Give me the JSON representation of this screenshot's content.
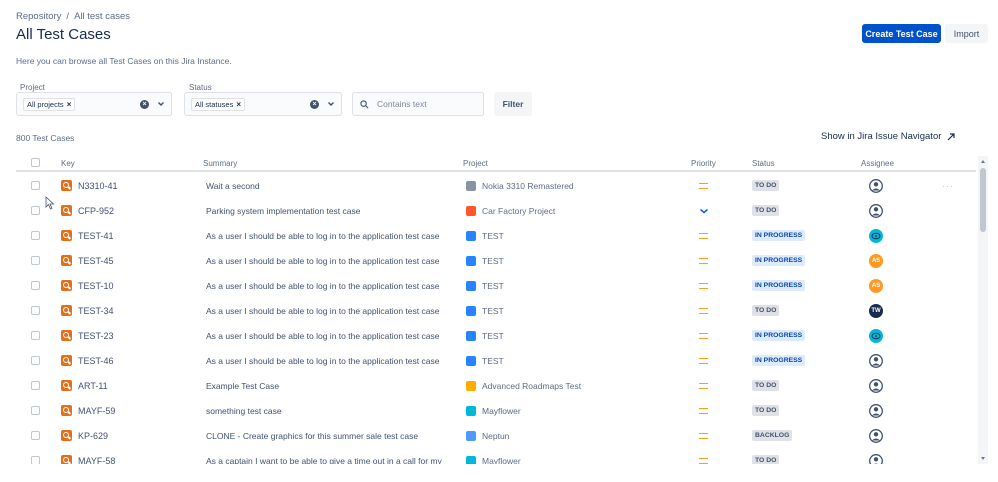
{
  "breadcrumb": {
    "items": [
      "Repository",
      "All test cases"
    ],
    "separator": "/"
  },
  "page": {
    "title": "All Test Cases",
    "description": "Here you can browse all Test Cases on this Jira Instance."
  },
  "actions": {
    "create_label": "Create Test Case",
    "import_label": "Import"
  },
  "filters": {
    "project_label": "Project",
    "project_chip": "All projects",
    "status_label": "Status",
    "status_chip": "All statuses",
    "search_placeholder": "Contains text",
    "filter_button": "Filter"
  },
  "summary": {
    "count_text": "800 Test Cases",
    "navigator_link": "Show in Jira Issue Navigator"
  },
  "table": {
    "columns": [
      "Key",
      "Summary",
      "Project",
      "Priority",
      "Status",
      "Assignee"
    ],
    "rows": [
      {
        "key": "N3310-41",
        "summary": "Wait a second",
        "project": "Nokia 3310 Remastered",
        "project_icon_color": "#8993a4",
        "priority": "medium",
        "status": "TO DO",
        "status_type": "todo",
        "assignee": ""
      },
      {
        "key": "CFP-952",
        "summary": "Parking system implementation test case",
        "project": "Car Factory Project",
        "project_icon_color": "#ff5630",
        "priority": "low",
        "status": "TO DO",
        "status_type": "todo",
        "assignee": ""
      },
      {
        "key": "TEST-41",
        "summary": "As a user I should be able to log in to the application test case",
        "project": "TEST",
        "project_icon_color": "#2684ff",
        "priority": "medium",
        "status": "IN PROGRESS",
        "status_type": "progress",
        "assignee": ""
      },
      {
        "key": "TEST-45",
        "summary": "As a user I should be able to log in to the application test case",
        "project": "TEST",
        "project_icon_color": "#2684ff",
        "priority": "medium",
        "status": "IN PROGRESS",
        "status_type": "progress",
        "assignee": "AS"
      },
      {
        "key": "TEST-10",
        "summary": "As a user I should be able to log in to the application test case",
        "project": "TEST",
        "project_icon_color": "#2684ff",
        "priority": "medium",
        "status": "IN PROGRESS",
        "status_type": "progress",
        "assignee": "AS"
      },
      {
        "key": "TEST-34",
        "summary": "As a user I should be able to log in to the application test case",
        "project": "TEST",
        "project_icon_color": "#2684ff",
        "priority": "medium",
        "status": "TO DO",
        "status_type": "todo",
        "assignee": "TW"
      },
      {
        "key": "TEST-23",
        "summary": "As a user I should be able to log in to the application test case",
        "project": "TEST",
        "project_icon_color": "#2684ff",
        "priority": "medium",
        "status": "IN PROGRESS",
        "status_type": "progress",
        "assignee": ""
      },
      {
        "key": "TEST-46",
        "summary": "As a user I should be able to log in to the application test case",
        "project": "TEST",
        "project_icon_color": "#2684ff",
        "priority": "medium",
        "status": "IN PROGRESS",
        "status_type": "progress",
        "assignee": ""
      },
      {
        "key": "ART-11",
        "summary": "Example Test Case",
        "project": "Advanced Roadmaps Test",
        "project_icon_color": "#ffab00",
        "priority": "medium",
        "status": "TO DO",
        "status_type": "todo",
        "assignee": ""
      },
      {
        "key": "MAYF-59",
        "summary": "something test case",
        "project": "Mayflower",
        "project_icon_color": "#00b8d9",
        "priority": "medium",
        "status": "TO DO",
        "status_type": "todo",
        "assignee": ""
      },
      {
        "key": "KP-629",
        "summary": "CLONE - Create graphics for this summer sale test case",
        "project": "Neptun",
        "project_icon_color": "#4c9aff",
        "priority": "medium",
        "status": "BACKLOG",
        "status_type": "todo",
        "assignee": ""
      },
      {
        "key": "MAYF-58",
        "summary": "As a captain I want to be able to give a time out in a call for my",
        "project": "Mayflower",
        "project_icon_color": "#00b8d9",
        "priority": "medium",
        "status": "TO DO",
        "status_type": "todo",
        "assignee": ""
      }
    ],
    "avatars": [
      {
        "row": 0,
        "type": "default"
      },
      {
        "row": 1,
        "type": "default"
      },
      {
        "row": 2,
        "type": "teal"
      },
      {
        "row": 3,
        "type": "orange"
      },
      {
        "row": 4,
        "type": "orange"
      },
      {
        "row": 5,
        "type": "navy"
      },
      {
        "row": 6,
        "type": "teal"
      },
      {
        "row": 7,
        "type": "default"
      },
      {
        "row": 8,
        "type": "default"
      },
      {
        "row": 9,
        "type": "default"
      },
      {
        "row": 10,
        "type": "default"
      },
      {
        "row": 11,
        "type": "default"
      }
    ]
  },
  "colors": {
    "primary": "#0052cc",
    "todo_bg": "#dfe1e6",
    "todo_fg": "#42526e",
    "progress_bg": "#deebff",
    "progress_fg": "#0747a6",
    "priority_medium": "#ff991f",
    "priority_low": "#0065ff",
    "issue_icon": "#e2701a"
  },
  "icons": {
    "row_action": "more-horizontal-icon",
    "navigator_link": "external-link-icon",
    "search": "search-icon"
  }
}
